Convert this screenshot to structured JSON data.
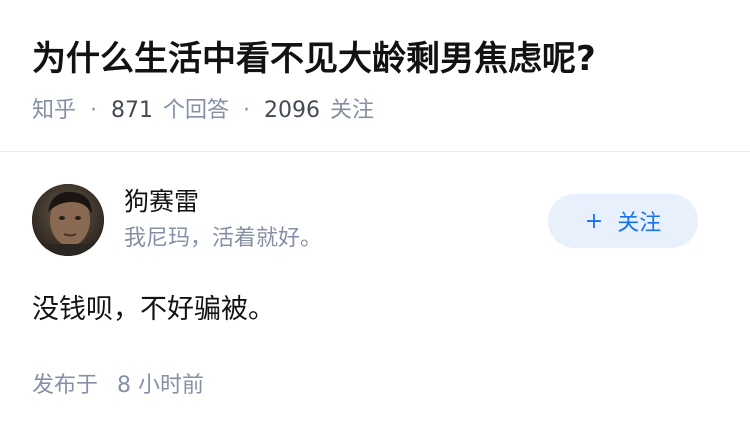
{
  "question": {
    "title": "为什么生活中看不见大龄剩男焦虑呢?",
    "source": "知乎",
    "answer_count": "871",
    "answer_label": "个回答",
    "follower_count": "2096",
    "follower_label": "关注"
  },
  "answer": {
    "author": {
      "name": "狗赛雷",
      "bio": "我尼玛，活着就好。"
    },
    "follow_button": {
      "icon": "plus-icon",
      "label": "关注"
    },
    "content": "没钱呗，不好骗被。",
    "footer": {
      "published_label": "发布于",
      "published_time": "8 小时前"
    }
  },
  "colors": {
    "title": "#121212",
    "meta": "#8590a6",
    "accent": "#1772f6",
    "follow_bg": "#e8f1fb"
  }
}
